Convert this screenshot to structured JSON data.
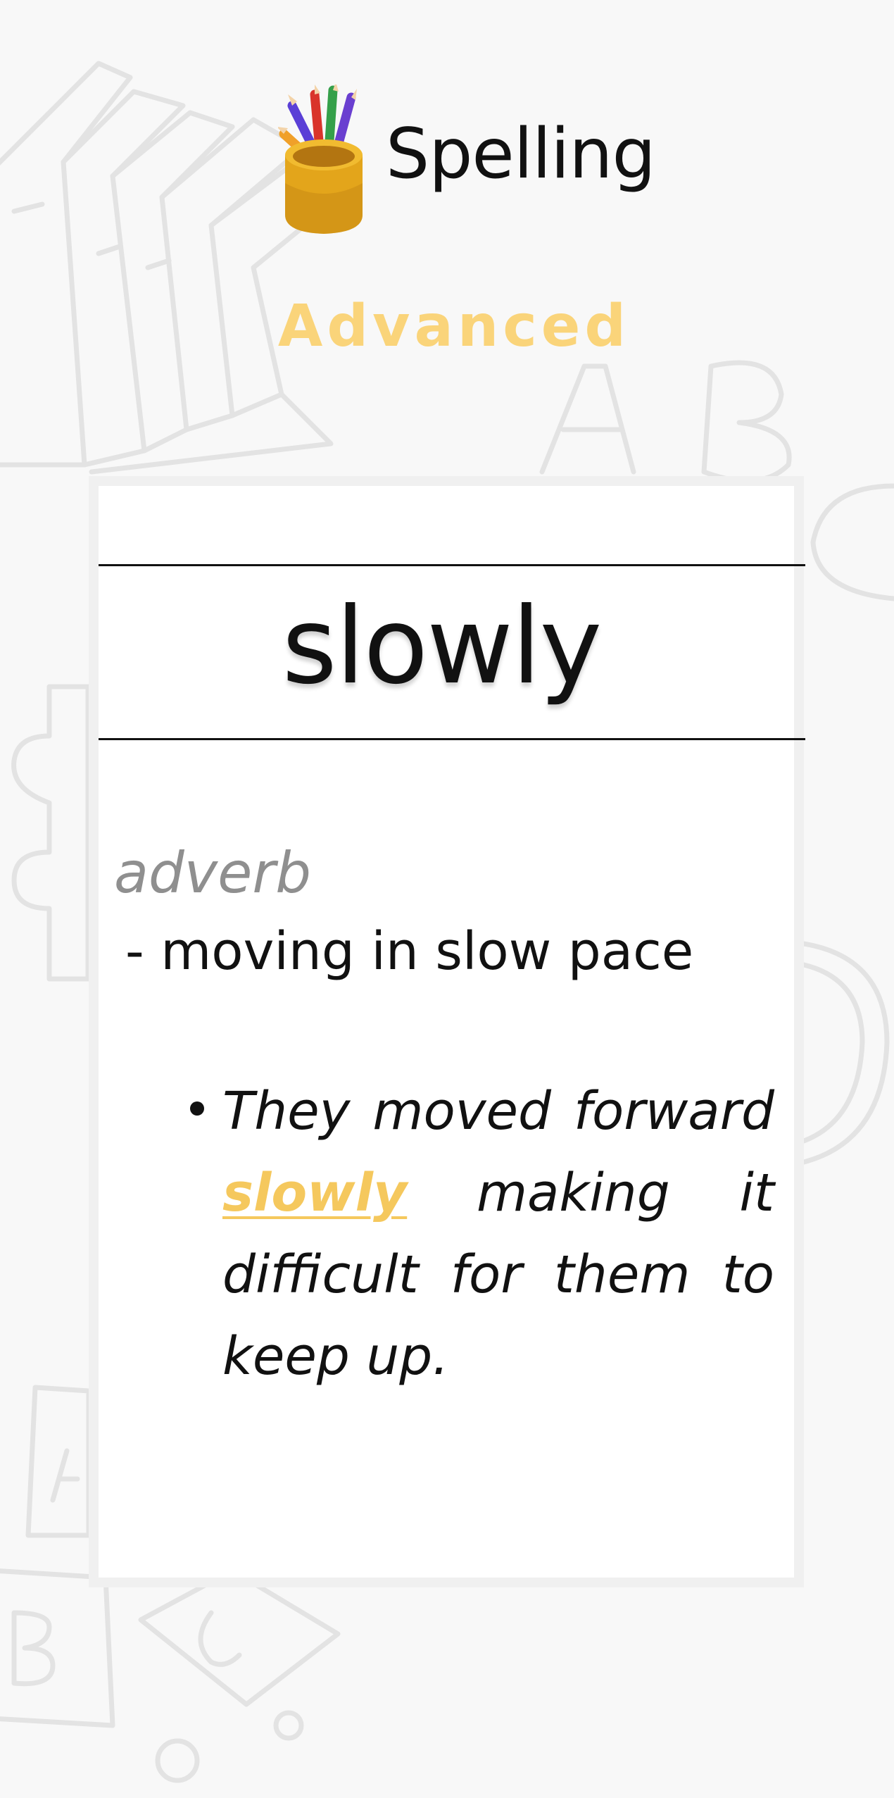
{
  "header": {
    "app_title": "Spelling",
    "logo_icon": "pencil-cup-icon",
    "level": "Advanced"
  },
  "card": {
    "word": "slowly",
    "part_of_speech": "adverb",
    "definition": "- moving in slow pace",
    "example": {
      "before": "They moved forward ",
      "highlight": "slowly",
      "after": " making it difficult for them to keep up."
    }
  },
  "colors": {
    "background": "#f8f8f8",
    "accent": "#fad47a",
    "highlight": "#f5c85d",
    "card_border": "#f0f0f0",
    "muted_text": "#8f8f8f"
  }
}
